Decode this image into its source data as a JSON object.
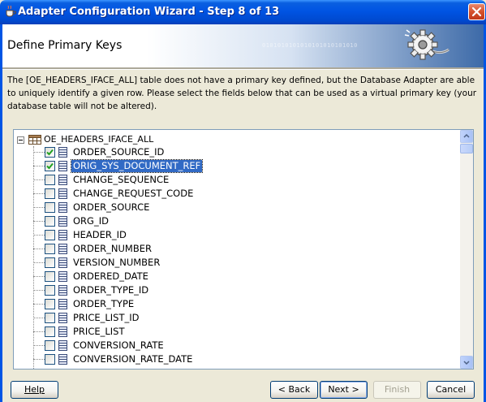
{
  "window": {
    "title": "Adapter Configuration Wizard - Step 8 of 13"
  },
  "header": {
    "title": "Define Primary Keys",
    "binary_decoration": "0101010101010101010101010"
  },
  "description": "The [OE_HEADERS_IFACE_ALL] table does not have a primary key defined, but the Database Adapter are able to uniquely identify a given row.  Please select the fields below that can be used as a virtual primary key (your database table will not be altered).",
  "tree": {
    "root_label": "OE_HEADERS_IFACE_ALL",
    "columns": [
      {
        "label": "ORDER_SOURCE_ID",
        "checked": true,
        "selected": false
      },
      {
        "label": "ORIG_SYS_DOCUMENT_REF",
        "checked": true,
        "selected": true
      },
      {
        "label": "CHANGE_SEQUENCE",
        "checked": false,
        "selected": false
      },
      {
        "label": "CHANGE_REQUEST_CODE",
        "checked": false,
        "selected": false
      },
      {
        "label": "ORDER_SOURCE",
        "checked": false,
        "selected": false
      },
      {
        "label": "ORG_ID",
        "checked": false,
        "selected": false
      },
      {
        "label": "HEADER_ID",
        "checked": false,
        "selected": false
      },
      {
        "label": "ORDER_NUMBER",
        "checked": false,
        "selected": false
      },
      {
        "label": "VERSION_NUMBER",
        "checked": false,
        "selected": false
      },
      {
        "label": "ORDERED_DATE",
        "checked": false,
        "selected": false
      },
      {
        "label": "ORDER_TYPE_ID",
        "checked": false,
        "selected": false
      },
      {
        "label": "ORDER_TYPE",
        "checked": false,
        "selected": false
      },
      {
        "label": "PRICE_LIST_ID",
        "checked": false,
        "selected": false
      },
      {
        "label": "PRICE_LIST",
        "checked": false,
        "selected": false
      },
      {
        "label": "CONVERSION_RATE",
        "checked": false,
        "selected": false
      },
      {
        "label": "CONVERSION_RATE_DATE",
        "checked": false,
        "selected": false
      }
    ]
  },
  "buttons": {
    "help": "Help",
    "back": "< Back",
    "next": "Next >",
    "finish": "Finish",
    "cancel": "Cancel"
  },
  "colors": {
    "titlebar": "#0054e3",
    "selection": "#316ac5",
    "dialog_bg": "#ece9d8"
  }
}
